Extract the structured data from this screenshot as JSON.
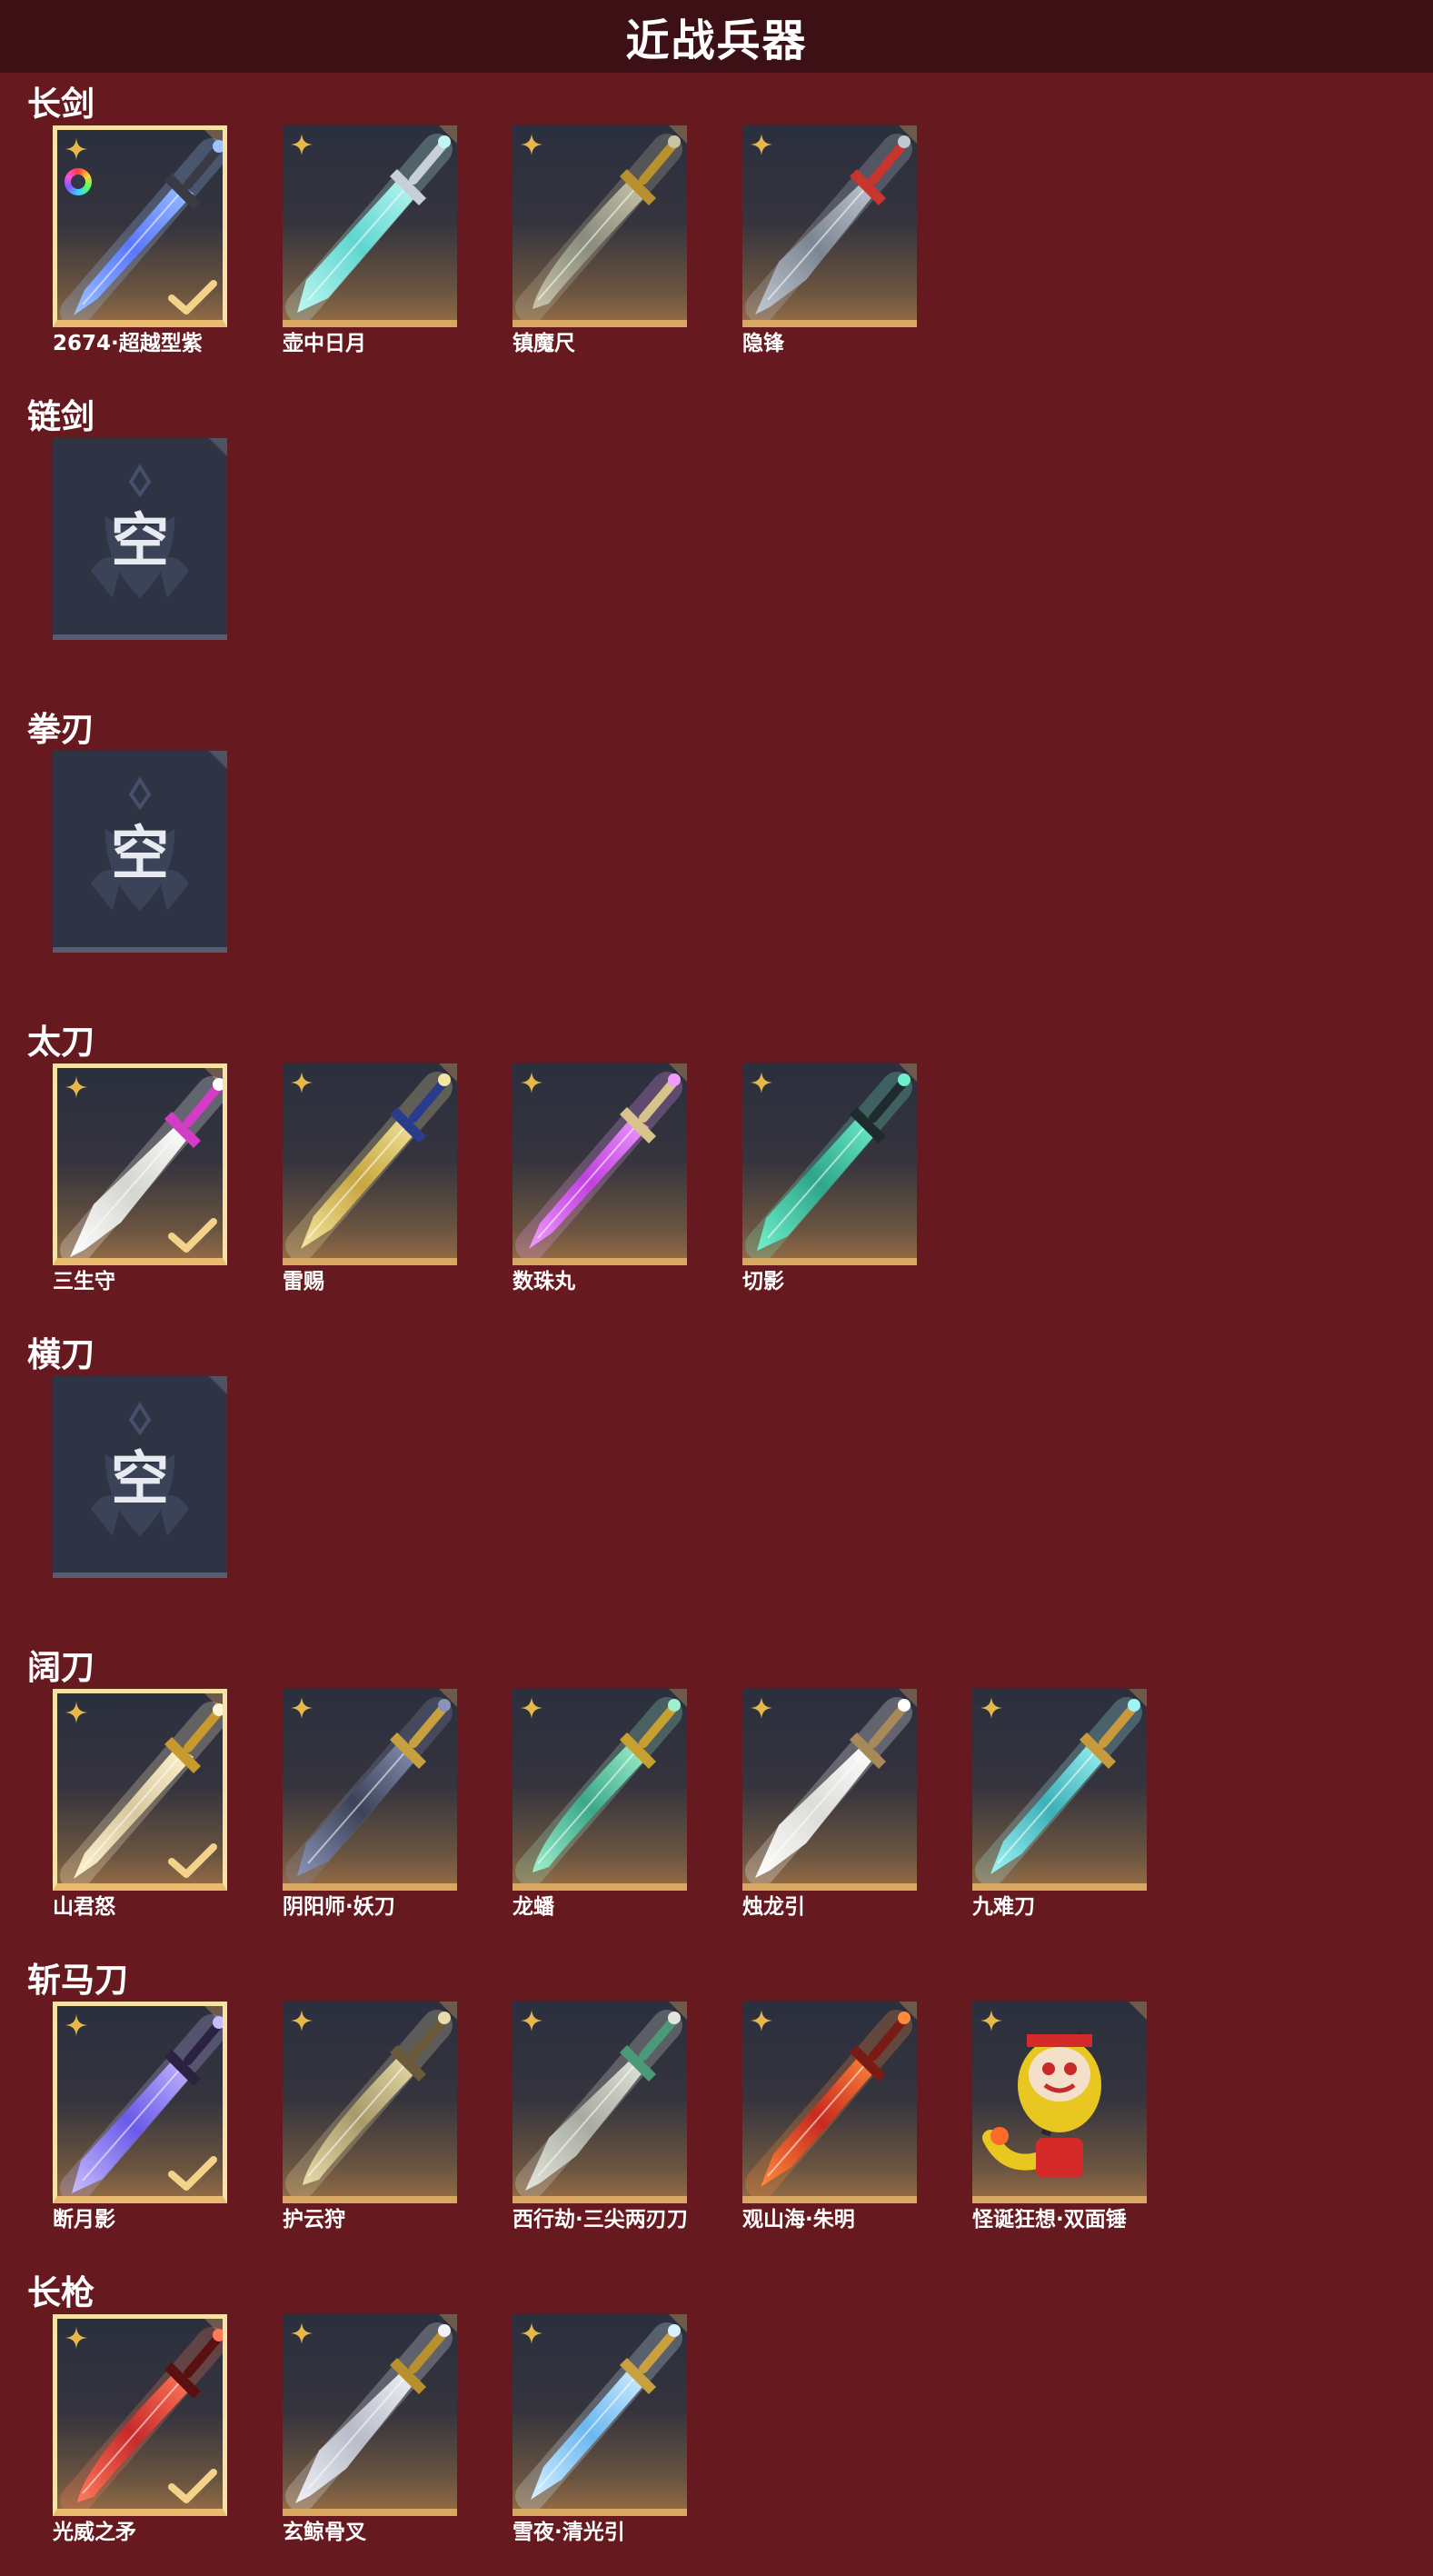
{
  "page": {
    "title": "近战兵器"
  },
  "empty_label": "空",
  "sections": [
    {
      "title": "长剑",
      "items": [
        {
          "name": "2674·超越型紫",
          "equipped": true,
          "rainbow": true,
          "blade": "#5a78ff",
          "glow": "#9cc2ff",
          "hilt": "#3a3a44"
        },
        {
          "name": "壶中日月",
          "equipped": false,
          "blade": "#5fd6d0",
          "glow": "#bff7f2",
          "hilt": "#c9cfd6"
        },
        {
          "name": "镇魔尺",
          "equipped": false,
          "blade": "#8a8c7e",
          "glow": "#c8c4a8",
          "hilt": "#b8902e"
        },
        {
          "name": "隐锋",
          "equipped": false,
          "blade": "#7c8692",
          "glow": "#c0c8d2",
          "hilt": "#c8342e"
        }
      ]
    },
    {
      "title": "链剑",
      "items": [
        {
          "name": "",
          "empty": true
        }
      ]
    },
    {
      "title": "拳刃",
      "items": [
        {
          "name": "",
          "empty": true
        }
      ]
    },
    {
      "title": "太刀",
      "items": [
        {
          "name": "三生守",
          "equipped": true,
          "blade": "#d6d6d0",
          "glow": "#ffffff",
          "hilt": "#d43cc8"
        },
        {
          "name": "雷赐",
          "equipped": false,
          "blade": "#c8a640",
          "glow": "#f2e6a0",
          "hilt": "#2a3c8c"
        },
        {
          "name": "数珠丸",
          "equipped": false,
          "blade": "#c040e0",
          "glow": "#f09cff",
          "hilt": "#d8c48a"
        },
        {
          "name": "切影",
          "equipped": false,
          "blade": "#2fa68a",
          "glow": "#6ff0cc",
          "hilt": "#1e2a2c"
        }
      ]
    },
    {
      "title": "横刀",
      "items": [
        {
          "name": "",
          "empty": true
        }
      ]
    },
    {
      "title": "阔刀",
      "items": [
        {
          "name": "山君怒",
          "equipped": true,
          "blade": "#d8c8a0",
          "glow": "#fff4d0",
          "hilt": "#c89a2e"
        },
        {
          "name": "阴阳师·妖刀",
          "equipped": false,
          "blade": "#3c4258",
          "glow": "#8a94b8",
          "hilt": "#c8a040"
        },
        {
          "name": "龙蟠",
          "equipped": false,
          "blade": "#3ca88a",
          "glow": "#9ff0cc",
          "hilt": "#c8a030"
        },
        {
          "name": "烛龙引",
          "equipped": false,
          "blade": "#dcdcd8",
          "glow": "#ffffff",
          "hilt": "#a88a5a"
        },
        {
          "name": "九难刀",
          "equipped": false,
          "blade": "#3cb0b8",
          "glow": "#a0f4f4",
          "hilt": "#c89a3c"
        }
      ]
    },
    {
      "title": "斩马刀",
      "items": [
        {
          "name": "断月影",
          "equipped": true,
          "blade": "#6a5ae8",
          "glow": "#c8bcff",
          "hilt": "#2a2240"
        },
        {
          "name": "护云狩",
          "equipped": false,
          "blade": "#a89a6a",
          "glow": "#e8dcaa",
          "hilt": "#6a5a3a"
        },
        {
          "name": "西行劫·三尖两刃刀",
          "equipped": false,
          "blade": "#a8aca0",
          "glow": "#e4e6dc",
          "hilt": "#4a9a7a"
        },
        {
          "name": "观山海·朱明",
          "equipped": false,
          "blade": "#c82a1e",
          "glow": "#ff8a3c",
          "hilt": "#7a1a14"
        },
        {
          "name": "怪诞狂想·双面锤",
          "equipped": false,
          "special": "hammer",
          "blade": "#e8c820",
          "glow": "#ffe870",
          "hilt": "#d42a2a"
        }
      ]
    },
    {
      "title": "长枪",
      "items": [
        {
          "name": "光威之矛",
          "equipped": true,
          "blade": "#c82a2a",
          "glow": "#ff7a5a",
          "hilt": "#5a1010"
        },
        {
          "name": "玄鲸骨叉",
          "equipped": false,
          "blade": "#b8bcc8",
          "glow": "#f0f2f8",
          "hilt": "#b8902e"
        },
        {
          "name": "雪夜·清光引",
          "equipped": false,
          "blade": "#6ab8f0",
          "glow": "#d8f0ff",
          "hilt": "#c8a040"
        }
      ]
    }
  ],
  "colors": {
    "background": "#661a1f",
    "header": "#3c1014",
    "card_border_gold": "#d8a762",
    "equipped_border": "#f6e1a6",
    "empty_card": "#2e3444"
  },
  "icons": {
    "rarity": "four-point-star-icon",
    "equipped": "checkmark-icon",
    "dye": "rainbow-ring-icon",
    "corner": "corner-tab-icon",
    "empty": "empty-slot-emblem-icon"
  }
}
